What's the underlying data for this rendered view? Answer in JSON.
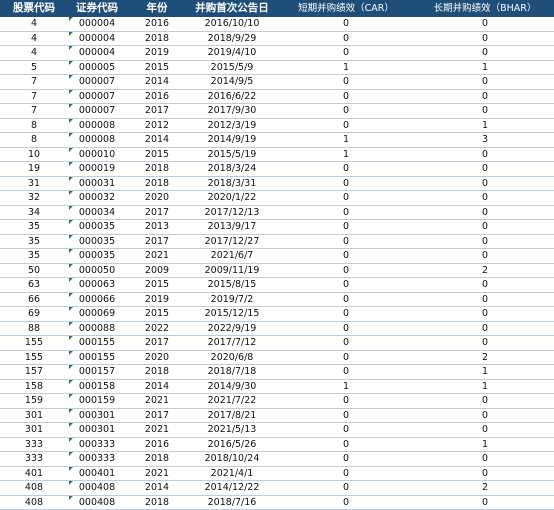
{
  "columns": [
    "股票代码",
    "证券代码",
    "年份",
    "并购首次公告日",
    "短期并购绩效（CAR）",
    "长期并购绩效（BHAR）"
  ],
  "flag_color": "#2e7d32",
  "header_color": "#1f4e79",
  "rows": [
    [
      "4",
      "000004",
      "2016",
      "2016/10/10",
      "0",
      "0"
    ],
    [
      "4",
      "000004",
      "2018",
      "2018/9/29",
      "0",
      "0"
    ],
    [
      "4",
      "000004",
      "2019",
      "2019/4/10",
      "0",
      "0"
    ],
    [
      "5",
      "000005",
      "2015",
      "2015/5/9",
      "1",
      "1"
    ],
    [
      "7",
      "000007",
      "2014",
      "2014/9/5",
      "0",
      "0"
    ],
    [
      "7",
      "000007",
      "2016",
      "2016/6/22",
      "0",
      "0"
    ],
    [
      "7",
      "000007",
      "2017",
      "2017/9/30",
      "0",
      "0"
    ],
    [
      "8",
      "000008",
      "2012",
      "2012/3/19",
      "0",
      "1"
    ],
    [
      "8",
      "000008",
      "2014",
      "2014/9/19",
      "1",
      "3"
    ],
    [
      "10",
      "000010",
      "2015",
      "2015/5/19",
      "1",
      "0"
    ],
    [
      "19",
      "000019",
      "2018",
      "2018/3/24",
      "0",
      "0"
    ],
    [
      "31",
      "000031",
      "2018",
      "2018/3/31",
      "0",
      "0"
    ],
    [
      "32",
      "000032",
      "2020",
      "2020/1/22",
      "0",
      "0"
    ],
    [
      "34",
      "000034",
      "2017",
      "2017/12/13",
      "0",
      "0"
    ],
    [
      "35",
      "000035",
      "2013",
      "2013/9/17",
      "0",
      "0"
    ],
    [
      "35",
      "000035",
      "2017",
      "2017/12/27",
      "0",
      "0"
    ],
    [
      "35",
      "000035",
      "2021",
      "2021/6/7",
      "0",
      "0"
    ],
    [
      "50",
      "000050",
      "2009",
      "2009/11/19",
      "0",
      "2"
    ],
    [
      "63",
      "000063",
      "2015",
      "2015/8/15",
      "0",
      "0"
    ],
    [
      "66",
      "000066",
      "2019",
      "2019/7/2",
      "0",
      "0"
    ],
    [
      "69",
      "000069",
      "2015",
      "2015/12/15",
      "0",
      "0"
    ],
    [
      "88",
      "000088",
      "2022",
      "2022/9/19",
      "0",
      "0"
    ],
    [
      "155",
      "000155",
      "2017",
      "2017/7/12",
      "0",
      "0"
    ],
    [
      "155",
      "000155",
      "2020",
      "2020/6/8",
      "0",
      "2"
    ],
    [
      "157",
      "000157",
      "2018",
      "2018/7/18",
      "0",
      "1"
    ],
    [
      "158",
      "000158",
      "2014",
      "2014/9/30",
      "1",
      "1"
    ],
    [
      "159",
      "000159",
      "2021",
      "2021/7/22",
      "0",
      "0"
    ],
    [
      "301",
      "000301",
      "2017",
      "2017/8/21",
      "0",
      "0"
    ],
    [
      "301",
      "000301",
      "2021",
      "2021/5/13",
      "0",
      "0"
    ],
    [
      "333",
      "000333",
      "2016",
      "2016/5/26",
      "0",
      "1"
    ],
    [
      "333",
      "000333",
      "2018",
      "2018/10/24",
      "0",
      "0"
    ],
    [
      "401",
      "000401",
      "2021",
      "2021/4/1",
      "0",
      "0"
    ],
    [
      "408",
      "000408",
      "2014",
      "2014/12/22",
      "0",
      "2"
    ],
    [
      "408",
      "000408",
      "2018",
      "2018/7/16",
      "0",
      "0"
    ]
  ]
}
